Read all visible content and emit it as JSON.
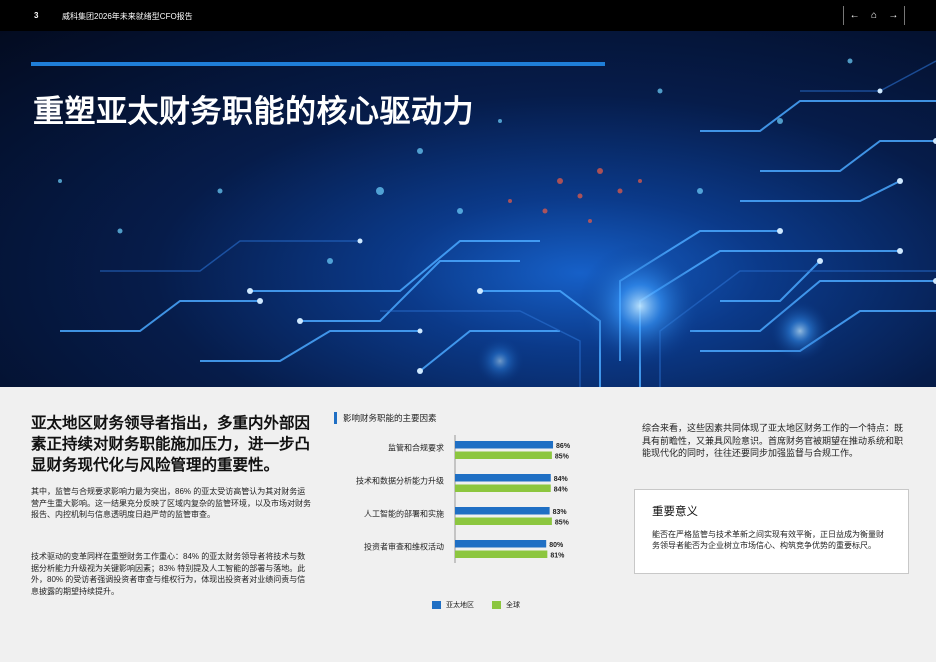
{
  "header": {
    "page_number": "3",
    "title": "威科集团2026年未来就绪型CFO报告",
    "nav": [
      "←",
      "⌂",
      "→"
    ]
  },
  "hero": {
    "title": "重塑亚太财务职能的核心驱动力"
  },
  "main": {
    "lead": "亚太地区财务领导者指出，多重内外部因素正持续对财务职能施加压力，进一步凸显财务现代化与风险管理的重要性。",
    "paragraph1": "其中，监管与合规要求影响力最为突出，86% 的亚太受访高管认为其对财务运营产生重大影响。这一结果充分反映了区域内复杂的监管环境，以及市场对财务报告、内控机制与信息透明度日趋严苛的监管审查。",
    "paragraph2": "技术驱动的变革同样在重塑财务工作重心：84% 的亚太财务领导者将技术与数据分析能力升级视为关键影响因素；83% 特别提及人工智能的部署与落地。此外，80% 的受访者强调投资者审查与维权行为，体现出投资者对业绩问责与信息披露的期望持续提升。",
    "summary": "综合来看，这些因素共同体现了亚太地区财务工作的一个特点：既具有前瞻性，又兼具风险意识。首席财务官被期望在推动系统和职能现代化的同时，往往还要同步加强监督与合规工作。"
  },
  "callout": {
    "title": "重要意义",
    "text": "能否在严格监管与技术革新之间实现有效平衡，正日益成为衡量财务领导者能否为企业树立市场信心、构筑竞争优势的重要标尺。"
  },
  "colors": {
    "apac": "#1f6fc4",
    "global": "#8cc63f",
    "accent": "#1f7ed8"
  },
  "chart_data": {
    "type": "bar",
    "orientation": "horizontal",
    "title": "影响财务职能的主要因素",
    "categories": [
      "监管和合规要求",
      "技术和数据分析能力升级",
      "人工智能的部署和实施",
      "投资者审查和维权活动"
    ],
    "series": [
      {
        "name": "亚太地区",
        "values": [
          86,
          84,
          83,
          80
        ]
      },
      {
        "name": "全球",
        "values": [
          85,
          84,
          85,
          81
        ]
      }
    ],
    "value_format": "{v}%",
    "xlim": [
      0,
      100
    ],
    "legend_position": "bottom"
  }
}
